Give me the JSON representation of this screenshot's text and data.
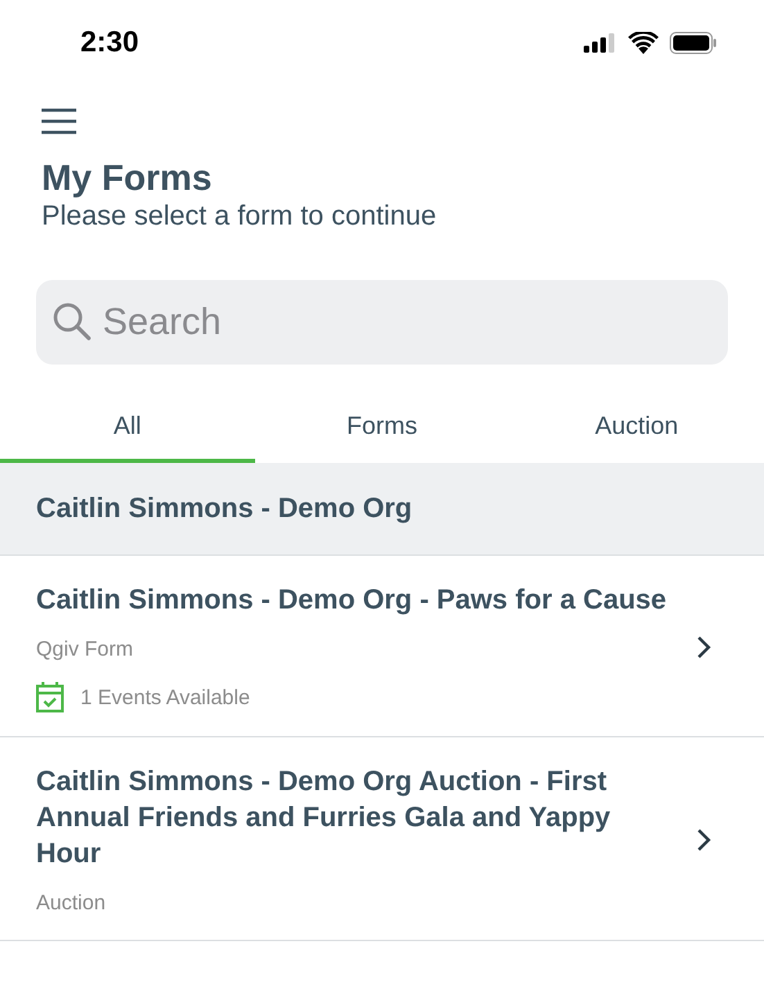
{
  "status_bar": {
    "time": "2:30"
  },
  "header": {
    "title": "My Forms",
    "subtitle": "Please select a form to continue"
  },
  "search": {
    "placeholder": "Search"
  },
  "tabs": [
    {
      "label": "All",
      "selected": true
    },
    {
      "label": "Forms",
      "selected": false
    },
    {
      "label": "Auction",
      "selected": false
    }
  ],
  "groups": [
    {
      "title": "Caitlin Simmons - Demo Org",
      "items": [
        {
          "title": "Caitlin Simmons - Demo Org - Paws for a Cause",
          "type": "Qgiv Form",
          "events": "1 Events Available"
        },
        {
          "title": "Caitlin Simmons - Demo Org Auction - First Annual Friends and Furries Gala and Yappy Hour",
          "type": "Auction"
        }
      ]
    }
  ]
}
